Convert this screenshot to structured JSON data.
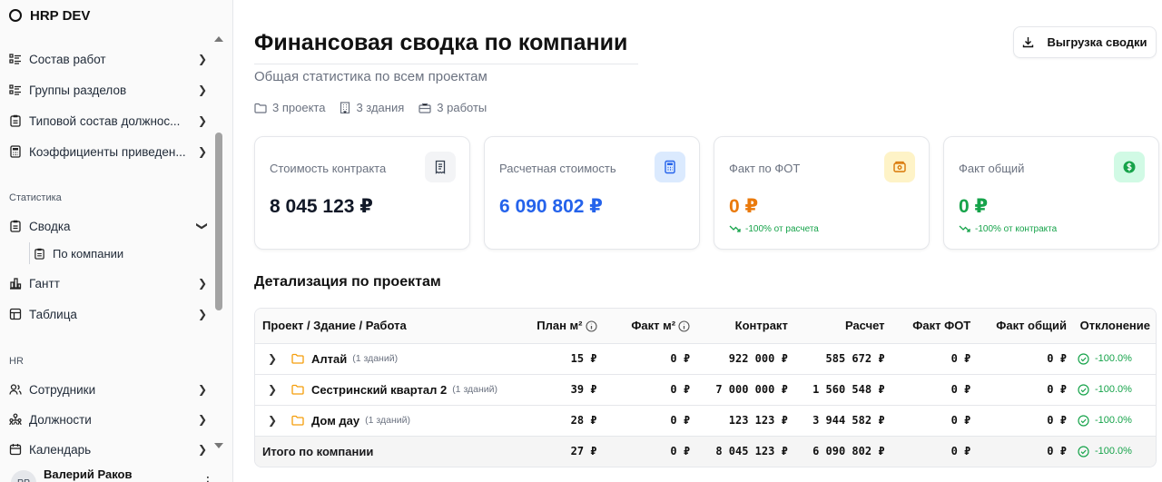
{
  "app": {
    "title": "HRP DEV"
  },
  "sidebar": {
    "items_top": [
      {
        "label": "Состав работ",
        "icon": "list-icon"
      },
      {
        "label": "Группы разделов",
        "icon": "list-icon"
      },
      {
        "label": "Типовой состав должнос...",
        "icon": "clipboard-icon"
      },
      {
        "label": "Коэффициенты приведен...",
        "icon": "calculator-icon"
      }
    ],
    "section_stats": "Статистика",
    "stats_items": [
      {
        "label": "Сводка",
        "icon": "clipboard-icon"
      },
      {
        "label": "Гантт",
        "icon": "gantt-icon"
      },
      {
        "label": "Таблица",
        "icon": "table-icon"
      }
    ],
    "sub_item": "По компании",
    "section_hr": "HR",
    "hr_items": [
      {
        "label": "Сотрудники",
        "icon": "users-icon"
      },
      {
        "label": "Должности",
        "icon": "org-icon"
      },
      {
        "label": "Календарь",
        "icon": "calendar-icon"
      }
    ],
    "user": {
      "initials": "RP",
      "name": "Валерий Раков"
    }
  },
  "header": {
    "title": "Финансовая сводка по компании",
    "subtitle": "Общая статистика по всем проектам",
    "meta": {
      "projects": "3 проекта",
      "buildings": "3 здания",
      "works": "3 работы"
    },
    "export_label": "Выгрузка сводки"
  },
  "cards": [
    {
      "label": "Стоимость контракта",
      "value": "8 045 123 ₽",
      "trend": "",
      "color": "#111827"
    },
    {
      "label": "Расчетная стоимость",
      "value": "6 090 802 ₽",
      "trend": "",
      "color": "#2563eb"
    },
    {
      "label": "Факт по ФОТ",
      "value": "0 ₽",
      "trend": "-100% от расчета",
      "color": "#ea7a0c"
    },
    {
      "label": "Факт общий",
      "value": "0 ₽",
      "trend": "-100% от контракта",
      "color": "#16a34a"
    }
  ],
  "details": {
    "title": "Детализация по проектам",
    "columns": [
      "Проект / Здание / Работа",
      "План м²",
      "Факт м²",
      "Контракт",
      "Расчет",
      "Факт ФОТ",
      "Факт общий",
      "Отклонение"
    ],
    "rows": [
      {
        "name": "Алтай",
        "count": "(1 зданий)",
        "plan": "15 ₽",
        "fact": "0 ₽",
        "contract": "922 000 ₽",
        "calc": "585 672 ₽",
        "fot": "0 ₽",
        "total": "0 ₽",
        "dev": "-100.0%"
      },
      {
        "name": "Сестринский квартал 2",
        "count": "(1 зданий)",
        "plan": "39 ₽",
        "fact": "0 ₽",
        "contract": "7 000 000 ₽",
        "calc": "1 560 548 ₽",
        "fot": "0 ₽",
        "total": "0 ₽",
        "dev": "-100.0%"
      },
      {
        "name": "Дом дау",
        "count": "(1 зданий)",
        "plan": "28 ₽",
        "fact": "0 ₽",
        "contract": "123 123 ₽",
        "calc": "3 944 582 ₽",
        "fot": "0 ₽",
        "total": "0 ₽",
        "dev": "-100.0%"
      }
    ],
    "total_row": {
      "name": "Итого по компании",
      "plan": "27 ₽",
      "fact": "0 ₽",
      "contract": "8 045 123 ₽",
      "calc": "6 090 802 ₽",
      "fot": "0 ₽",
      "total": "0 ₽",
      "dev": "-100.0%"
    }
  }
}
